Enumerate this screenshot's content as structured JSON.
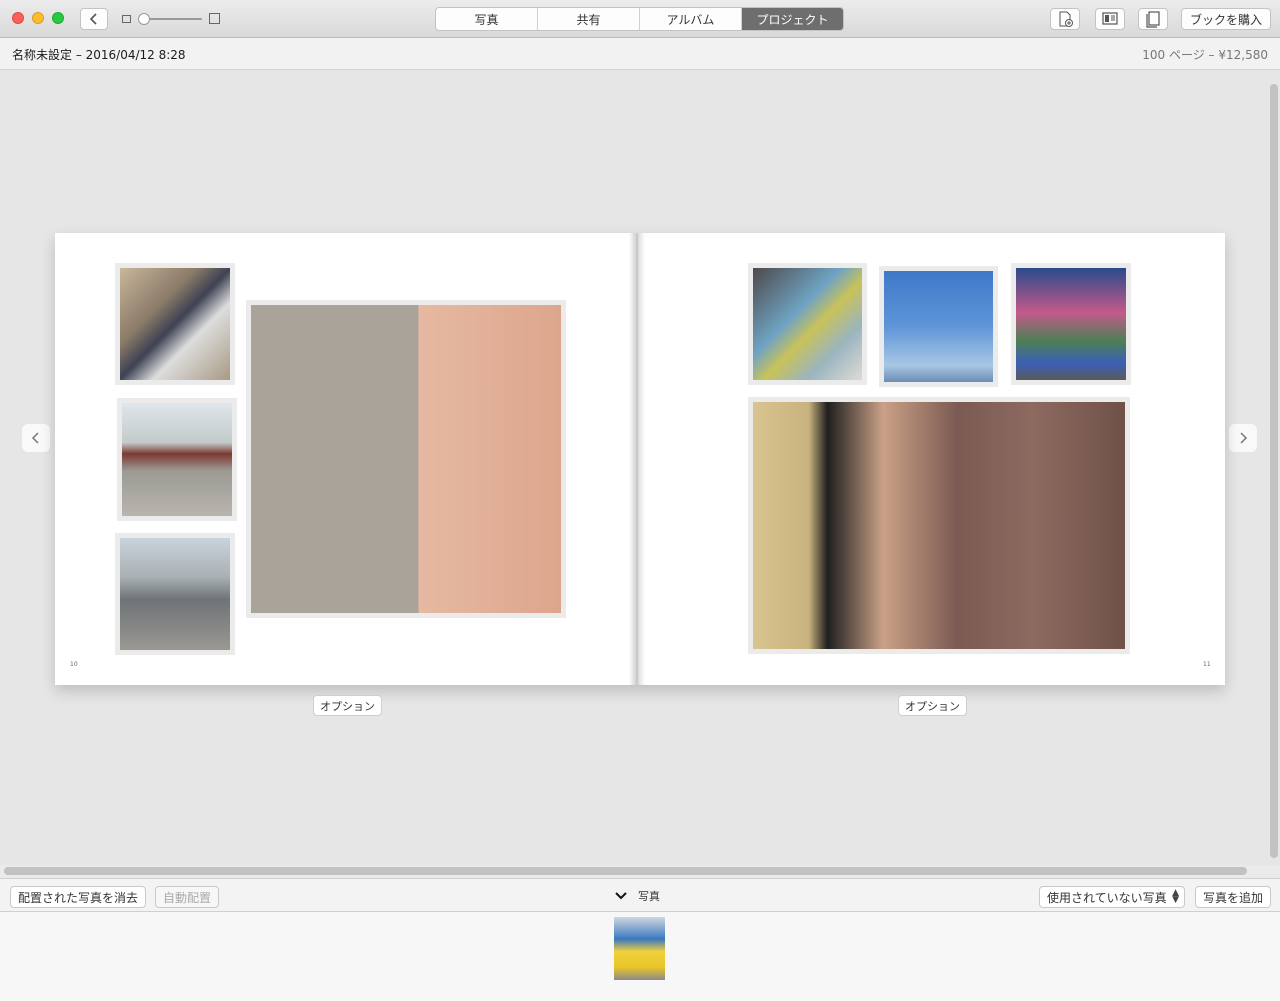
{
  "toolbar": {
    "tabs": [
      {
        "label": "写真",
        "active": false
      },
      {
        "label": "共有",
        "active": false
      },
      {
        "label": "アルバム",
        "active": false
      },
      {
        "label": "プロジェクト",
        "active": true
      }
    ],
    "buy_label": "ブックを購入",
    "icons": [
      "back-icon",
      "thumbnail-small-icon",
      "thumbnail-large-icon",
      "add-page-icon",
      "layout-icon",
      "page-view-icon"
    ]
  },
  "titlebar": {
    "title": "名称未設定 – 2016/04/12 8:28",
    "info": "100 ページ – ¥12,580"
  },
  "book": {
    "left_page_number": "10",
    "right_page_number": "11",
    "options_label": "オプション"
  },
  "bottombar": {
    "clear_label": "配置された写真を消去",
    "autofill_label": "自動配置",
    "photos_label": "写真",
    "filter_value": "使用されていない写真",
    "add_label": "写真を追加"
  },
  "colors": {
    "active_tab": "#6e6e6e",
    "close": "#fc5f57",
    "minimize": "#fdbc2e",
    "maximize": "#28c840"
  }
}
